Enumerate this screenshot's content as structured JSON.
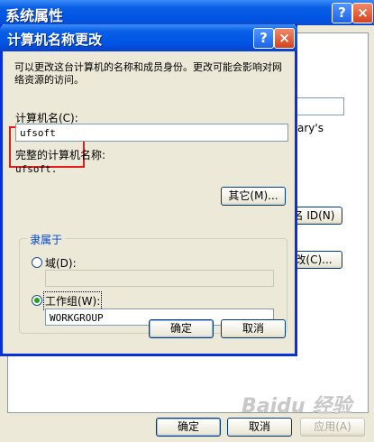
{
  "background_window": {
    "title": "系统属性",
    "partial_text_1": "ary's",
    "partial_button_1": "名 ID(N)",
    "partial_button_2": "改(C)...",
    "ok_label": "确定",
    "cancel_label": "取消",
    "apply_label": "应用(A)"
  },
  "dialog": {
    "title": "计算机名称更改",
    "description": "可以更改这台计算机的名称和成员身份。更改可能会影响对网络资源的访问。",
    "computer_name_label": "计算机名(C):",
    "computer_name_value": "ufsoft",
    "full_name_label": "完整的计算机名称:",
    "full_name_value": "ufsoft.",
    "more_button": "其它(M)...",
    "member_of": {
      "group_label": "隶属于",
      "domain_label": "域(D):",
      "domain_value": "",
      "domain_selected": false,
      "workgroup_label": "工作组(W):",
      "workgroup_value": "WORKGROUP",
      "workgroup_selected": true
    },
    "ok_label": "确定",
    "cancel_label": "取消"
  },
  "watermark": "Baidu 经验"
}
